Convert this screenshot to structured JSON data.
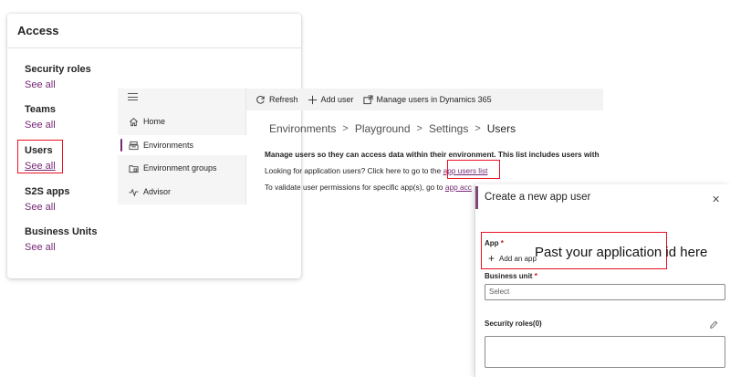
{
  "access": {
    "title": "Access",
    "sections": [
      {
        "title": "Security roles",
        "link": "See all"
      },
      {
        "title": "Teams",
        "link": "See all"
      },
      {
        "title": "Users",
        "link": "See all"
      },
      {
        "title": "S2S apps",
        "link": "See all"
      },
      {
        "title": "Business Units",
        "link": "See all"
      }
    ]
  },
  "nav": {
    "items": [
      {
        "label": "Home",
        "icon": "home-icon"
      },
      {
        "label": "Environments",
        "icon": "environments-icon",
        "active": true
      },
      {
        "label": "Environment groups",
        "icon": "environment-groups-icon"
      },
      {
        "label": "Advisor",
        "icon": "advisor-icon"
      }
    ]
  },
  "toolbar": {
    "refresh": "Refresh",
    "add_user": "Add user",
    "manage_users": "Manage users in Dynamics 365"
  },
  "breadcrumb": [
    "Environments",
    "Playground",
    "Settings",
    "Users"
  ],
  "content": {
    "manage_text": "Manage users so they can access data within their environment. This list includes users with",
    "app_users_prefix": "Looking for application users? Click here to go to the ",
    "app_users_link": "app users list",
    "validate_prefix": "To validate user permissions for specific app(s), go to ",
    "validate_link": "app acc"
  },
  "panel": {
    "title": "Create a new app user",
    "app_label": "App",
    "add_app": "Add an app",
    "business_unit_label": "Business unit",
    "business_unit_placeholder": "Select",
    "security_roles_label": "Security roles(0)",
    "required_marker": "*"
  },
  "annotation": "Past your application id here",
  "colors": {
    "accent": "#742774",
    "highlight_box": "#e81123"
  }
}
